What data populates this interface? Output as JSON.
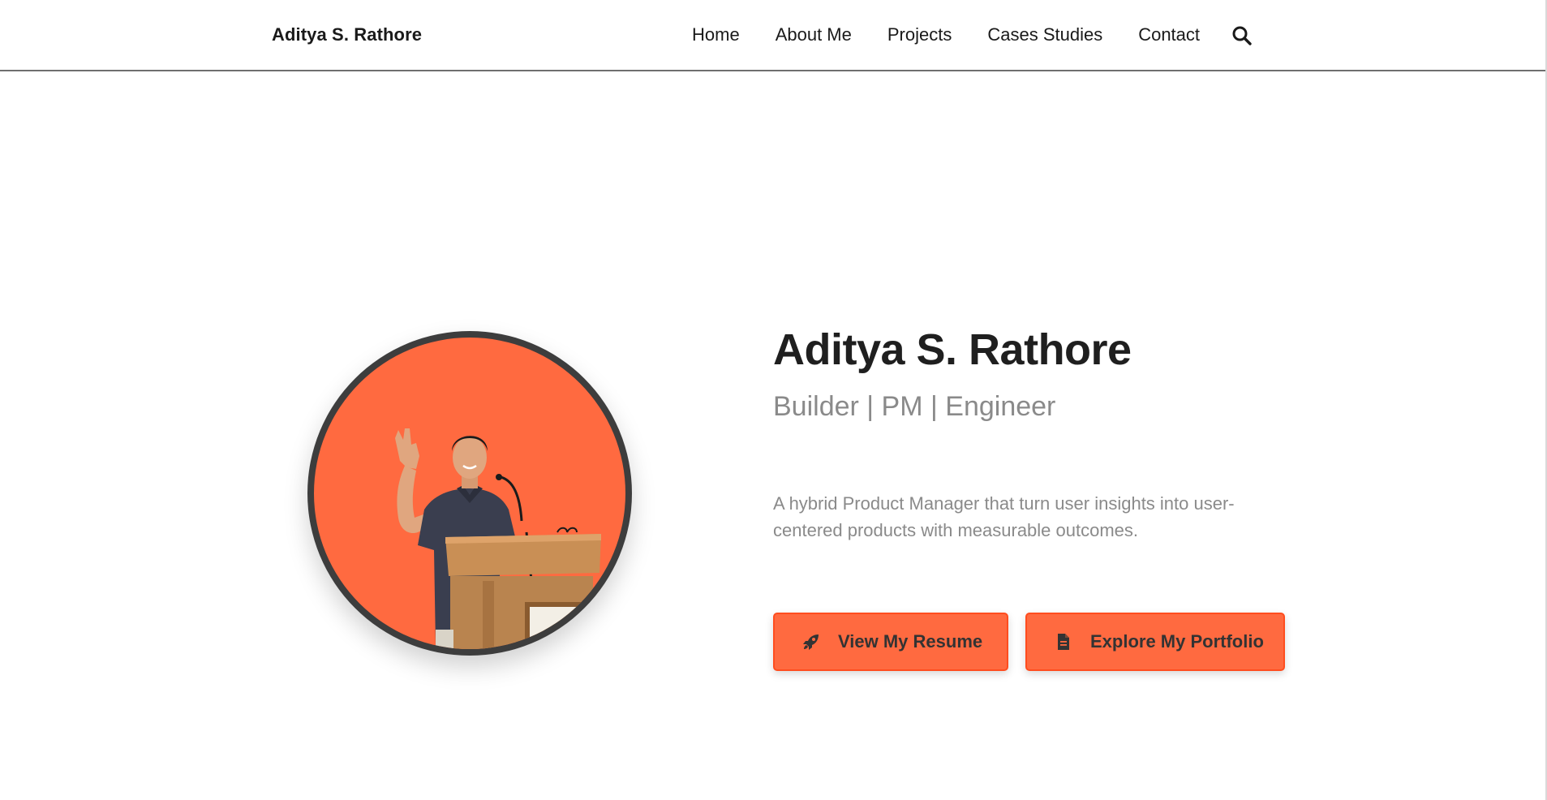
{
  "nav": {
    "brand": "Aditya S. Rathore",
    "links": [
      "Home",
      "About Me",
      "Projects",
      "Cases Studies",
      "Contact"
    ],
    "search_icon": "search-icon"
  },
  "hero": {
    "name": "Aditya S. Rathore",
    "role": "Builder | PM | Engineer",
    "description": "A hybrid Product Manager that turn user insights into user-centered products with measurable outcomes.",
    "photo_icon": "profile-photo",
    "buttons": {
      "resume": {
        "label": "View My Resume",
        "icon": "rocket-icon"
      },
      "portfolio": {
        "label": "Explore My Portfolio",
        "icon": "document-icon"
      }
    }
  },
  "colors": {
    "accent": "#ff6a40",
    "accent_border": "#ff4d1f",
    "text_dark": "#1f1f1f",
    "text_muted": "#8a8a8a",
    "avatar_ring": "#3d3d3d"
  }
}
